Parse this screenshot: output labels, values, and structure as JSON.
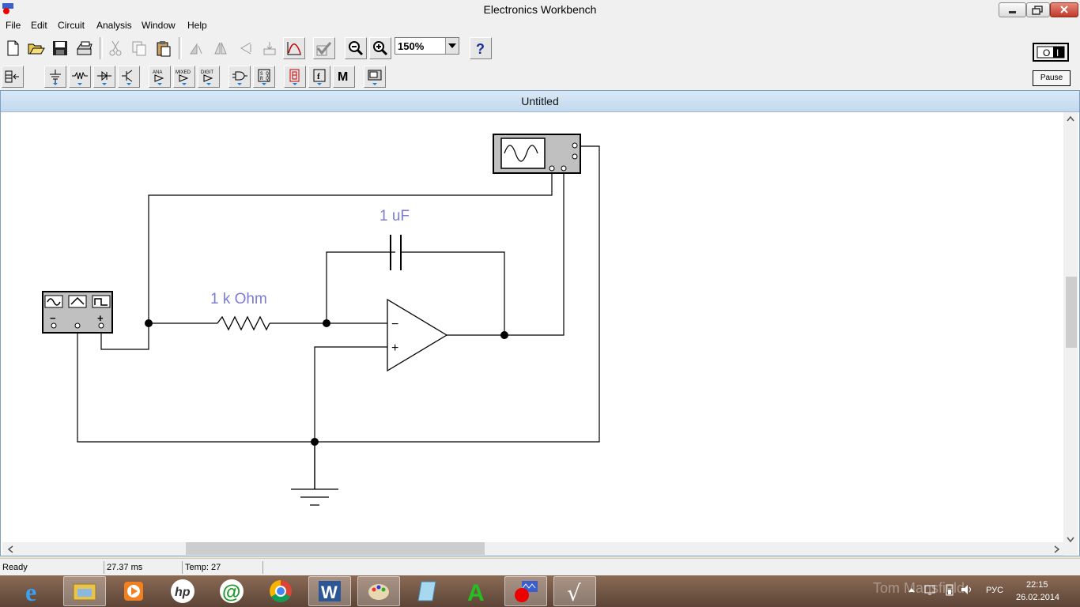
{
  "window": {
    "title": "Electronics Workbench"
  },
  "menu": [
    "File",
    "Edit",
    "Circuit",
    "Analysis",
    "Window",
    "Help"
  ],
  "toolbar": {
    "zoom_value": "150%"
  },
  "controls": {
    "pause_label": "Pause",
    "power_label": "O I"
  },
  "document": {
    "title": "Untitled"
  },
  "circuit": {
    "resistor_label": "1 k Ohm",
    "capacitor_label": "1 uF",
    "opamp_minus": "−",
    "opamp_plus": "+",
    "generator_minus": "−",
    "generator_plus": "+"
  },
  "statusbar": {
    "status": "Ready",
    "time": "27.37 ms",
    "temp": "Temp:  27"
  },
  "taskbar": {
    "watermark": "Tom Mansfield",
    "language": "РУС",
    "time": "22:15",
    "date": "26.02.2014"
  },
  "colors": {
    "component_label": "#7b7bd8",
    "wire": "#000000",
    "instrument": "#c0c0c0"
  }
}
